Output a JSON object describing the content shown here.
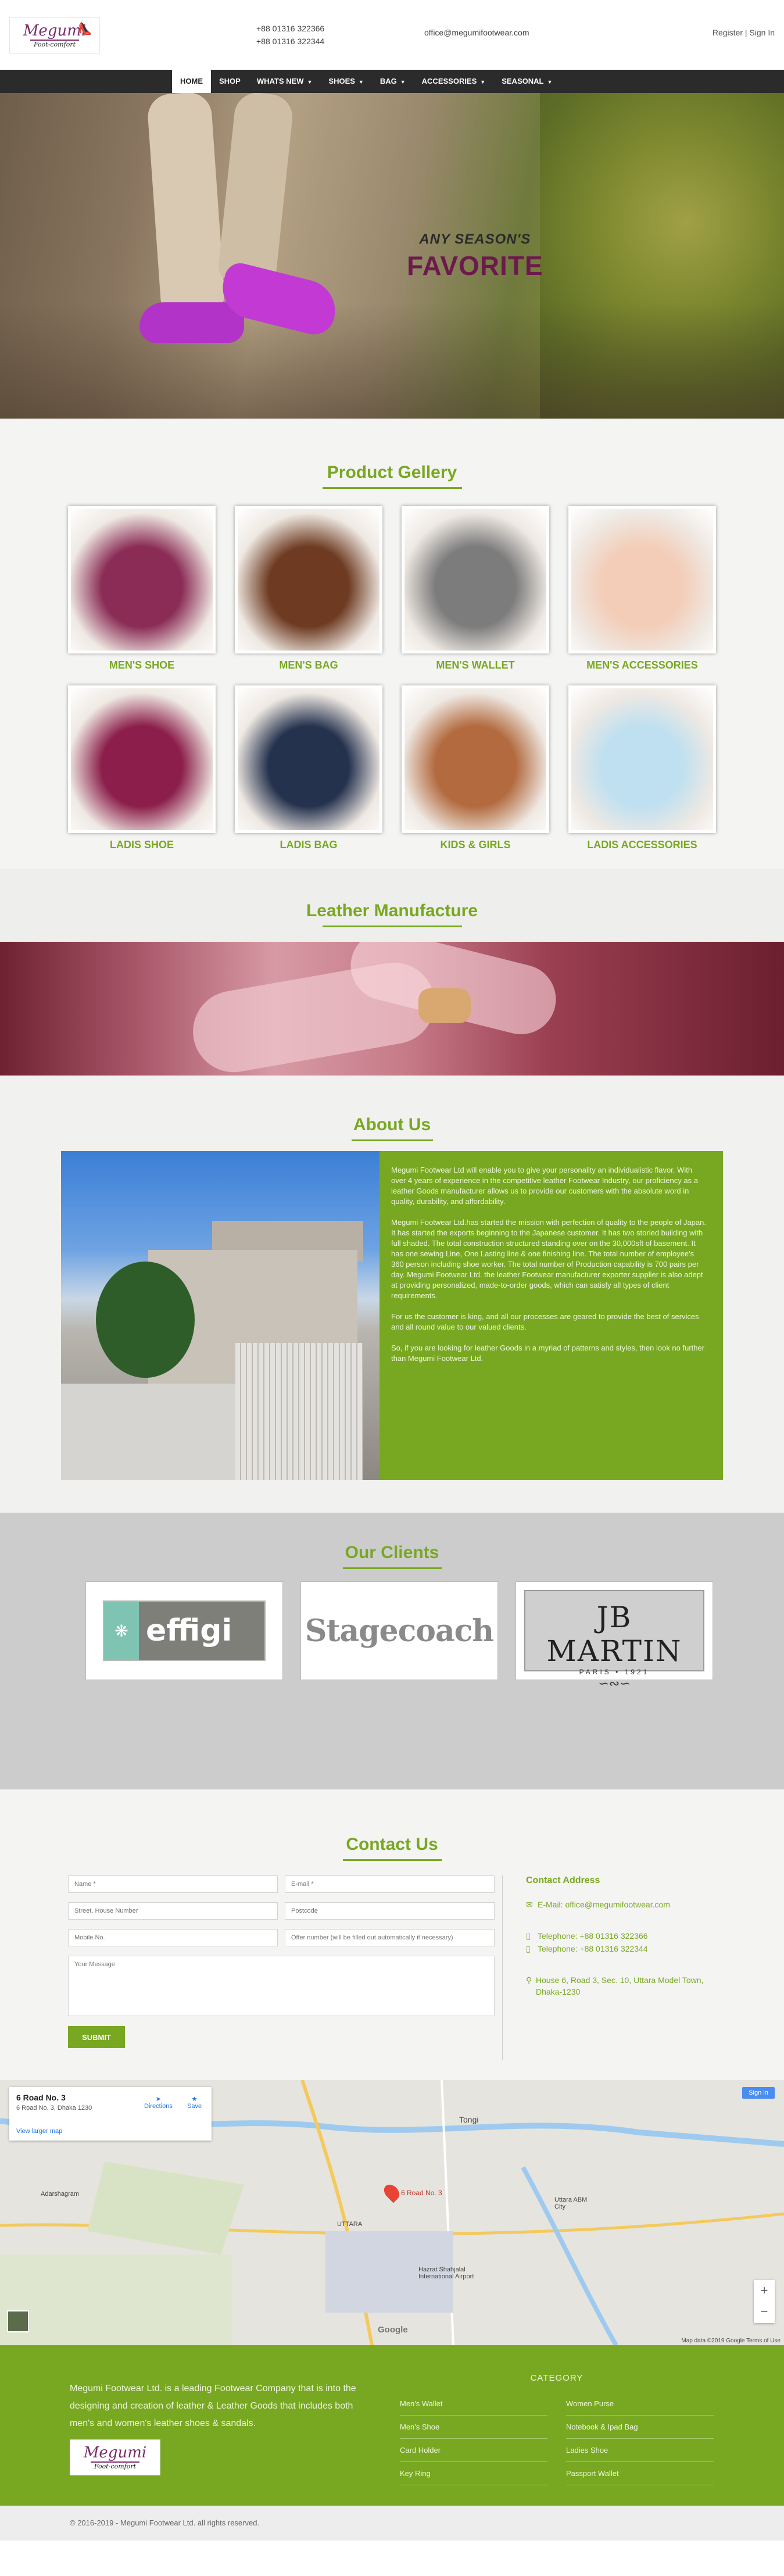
{
  "brand": {
    "logo_main": "Megumi",
    "logo_sub": "Foot-comfort"
  },
  "topbar": {
    "phone1": "+88 01316 322366",
    "phone2": "+88 01316 322344",
    "email": "office@megumifootwear.com",
    "register": "Register",
    "separator": "|",
    "signin": "Sign In"
  },
  "nav": {
    "items": [
      {
        "label": "HOME",
        "caret": false
      },
      {
        "label": "SHOP",
        "caret": false
      },
      {
        "label": "WHATS NEW",
        "caret": true
      },
      {
        "label": "SHOES",
        "caret": true
      },
      {
        "label": "BAG",
        "caret": true
      },
      {
        "label": "ACCESSORIES",
        "caret": true
      },
      {
        "label": "SEASONAL",
        "caret": true
      }
    ]
  },
  "hero": {
    "small": "ANY SEASON'S",
    "big": "FAVORITE"
  },
  "gallery": {
    "title": "Product Gellery",
    "items": [
      {
        "label": "MEN'S SHOE",
        "color": "#8a2c55"
      },
      {
        "label": "MEN'S BAG",
        "color": "#6e3b22"
      },
      {
        "label": "MEN'S WALLET",
        "color": "#7c7c7c"
      },
      {
        "label": "MEN'S ACCESSORIES",
        "color": "#f3cdb8"
      },
      {
        "label": "LADIS SHOE",
        "color": "#8b1e4a"
      },
      {
        "label": "LADIS BAG",
        "color": "#25324e"
      },
      {
        "label": "KIDS & GIRLS",
        "color": "#b26a3e"
      },
      {
        "label": "LADIS ACCESSORIES",
        "color": "#bfe0f0"
      }
    ]
  },
  "manufacture": {
    "title": "Leather Manufacture"
  },
  "about": {
    "title": "About Us",
    "paragraphs": [
      "Megumi Footwear Ltd will enable you to give your personality an individualistic flavor. With over 4 years of experience in the competitive leather Footwear Industry, our proficiency as a leather Goods manufacturer allows us to provide our customers with the absolute word in quality, durability, and affordability.",
      "Megumi Footwear Ltd.has started the mission with perfection of quality to the people of Japan. It has started the exports beginning to the Japanese customer. It has two storied building with full shaded. The total construction structured standing over on the 30,000sft of basement. It has one sewing Line, One Lasting line & one finishing line. The total number of employee's 360 person including shoe worker. The total number of Production capability is 700 pairs per day. Megumi Footwear Ltd. the leather Footwear manufacturer exporter supplier is also adept at providing personalized, made-to-order goods, which can satisfy all types of client requirements.",
      "For us the customer is king, and all our processes are geared to provide the best of services and all round value to our valued clients.",
      "So, if you are looking for leather Goods in a myriad of patterns and styles, then look no further than Megumi Footwear Ltd."
    ]
  },
  "clients": {
    "title": "Our Clients",
    "logos": [
      "effigi",
      "Stagecoach",
      "JB MARTIN"
    ],
    "jb_year": "PARIS • 1921"
  },
  "contact": {
    "title": "Contact Us",
    "placeholders": {
      "name": "Name *",
      "email": "E-mail *",
      "street": "Street, House Number",
      "postcode": "Postcode",
      "mobile": "Mobile No.",
      "offer": "Offer number (will be filled out automatically if necessary)",
      "message": "Your Message"
    },
    "submit": "SUBMIT",
    "address_title": "Contact Address",
    "email_line": "E-Mail: office@megumifootwear.com",
    "tel1": "Telephone: +88 01316 322366",
    "tel2": "Telephone: +88 01316 322344",
    "address": "House 6, Road 3, Sec. 10, Uttara Model Town, Dhaka-1230"
  },
  "map": {
    "place": "6 Road No. 3",
    "place_sub": "6 Road No. 3, Dhaka 1230",
    "larger": "View larger map",
    "directions": "Directions",
    "save": "Save",
    "signin": "Sign in",
    "pin_label": "6 Road No. 3",
    "labels": [
      "Tongi",
      "UTTARA",
      "Uttara ABM City",
      "Adarshagram",
      "Hazrat Shahjalal International Airport"
    ],
    "google": "Google",
    "footer": "Map data ©2019 Google   Terms of Use"
  },
  "footer": {
    "about": "Megumi Footwear Ltd. is a leading Footwear Company that is into the designing and creation of leather & Leather Goods that includes both men's and women's leather shoes & sandals.",
    "category_title": "CATEGORY",
    "categories": [
      "Men's Wallet",
      "Women Purse",
      "Men's Shoe",
      "Notebook & Ipad Bag",
      "Card Holder",
      "Ladies Shoe",
      "Key Ring",
      "Passport Wallet"
    ],
    "copyright": "© 2016-2019 - Megumi Footwear Ltd. all rights reserved."
  }
}
